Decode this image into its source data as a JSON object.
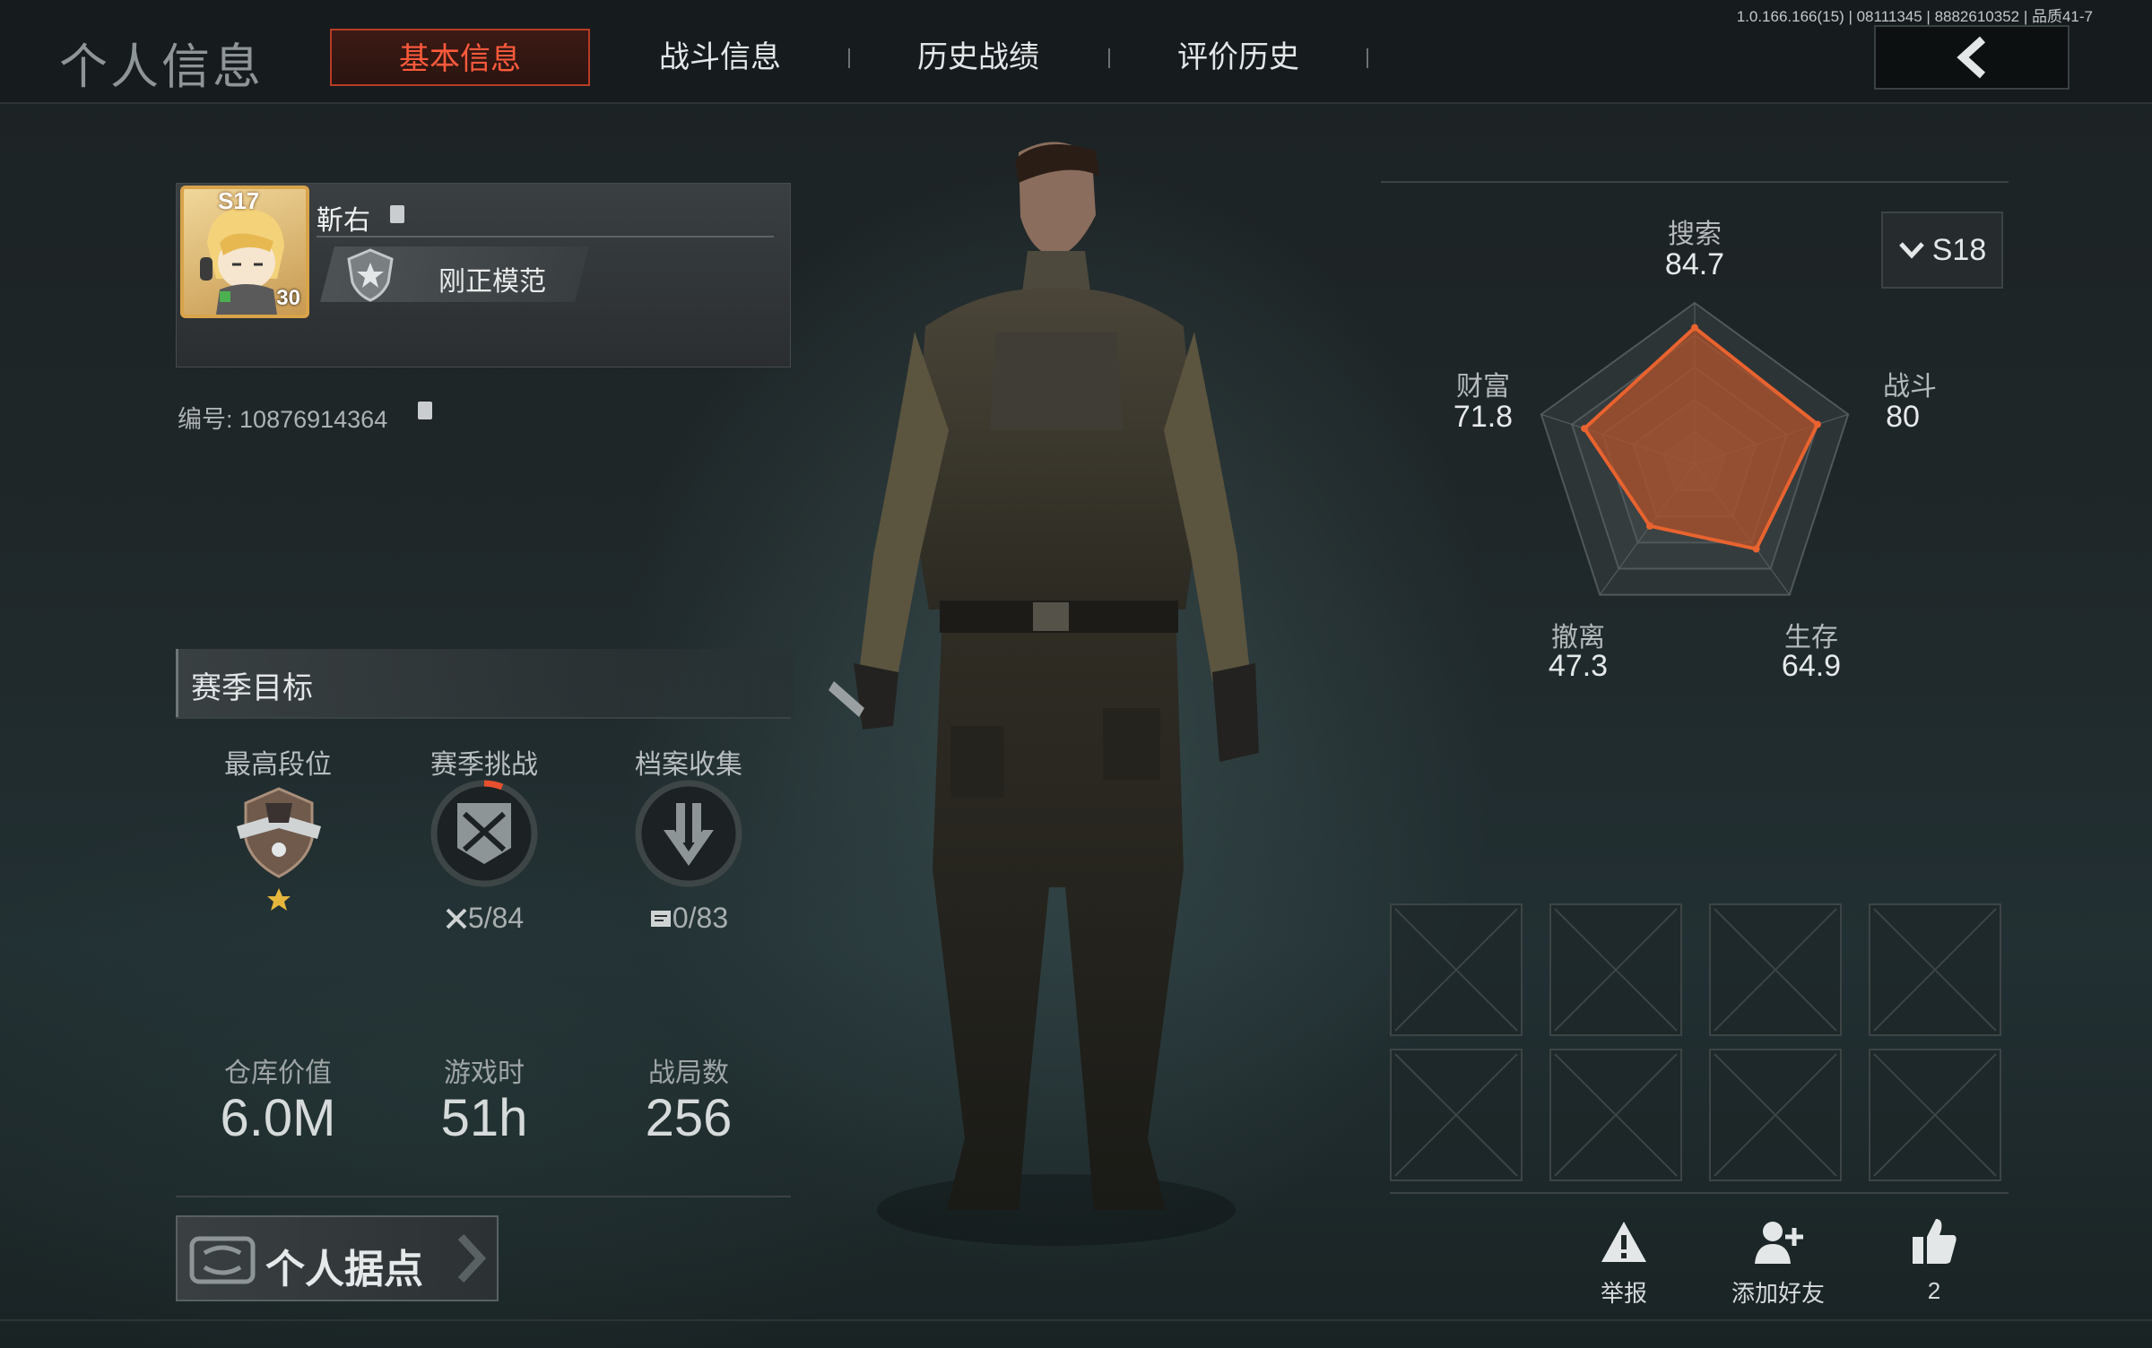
{
  "header": {
    "page_title": "个人信息",
    "tabs": [
      {
        "label": "基本信息",
        "active": true
      },
      {
        "label": "战斗信息",
        "active": false
      },
      {
        "label": "历史战绩",
        "active": false
      },
      {
        "label": "评价历史",
        "active": false
      }
    ],
    "version": "1.0.166.166(15) | 08111345 | 8882610352 | 品质41-7"
  },
  "profile": {
    "avatar_rank": "S17",
    "avatar_level": "30",
    "name": "靳右",
    "title": "刚正模范",
    "id_label": "编号:",
    "id_value": "10876914364"
  },
  "season_goals": {
    "title": "赛季目标",
    "items": [
      {
        "label": "最高段位",
        "value": ""
      },
      {
        "label": "赛季挑战",
        "value": "5/84"
      },
      {
        "label": "档案收集",
        "value": "0/83"
      }
    ]
  },
  "stats": [
    {
      "label": "仓库价值",
      "value": "6.0M"
    },
    {
      "label": "游戏时",
      "value": "51h"
    },
    {
      "label": "战局数",
      "value": "256"
    }
  ],
  "base_button": {
    "label": "个人据点"
  },
  "season_selector": {
    "label": "S18"
  },
  "chart_data": {
    "type": "radar",
    "axes": [
      "搜索",
      "战斗",
      "生存",
      "撤离",
      "财富"
    ],
    "values": [
      84.7,
      80,
      64.9,
      47.3,
      71.8
    ],
    "value_labels": [
      "84.7",
      "80",
      "64.9",
      "47.3",
      "71.8"
    ],
    "max": 100,
    "fill_color": "#b0502a",
    "stroke_color": "#e8632f"
  },
  "actions": [
    {
      "label": "举报",
      "icon": "warning-icon"
    },
    {
      "label": "添加好友",
      "icon": "add-friend-icon"
    },
    {
      "label": "2",
      "icon": "thumbs-up-icon"
    }
  ],
  "colors": {
    "accent": "#ff5a3c",
    "gold": "#d8a34a"
  }
}
